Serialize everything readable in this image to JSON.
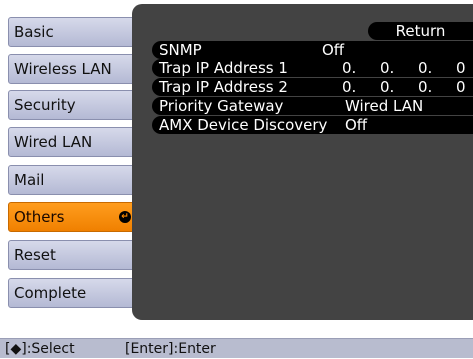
{
  "sidebar": {
    "items": [
      {
        "label": "Basic"
      },
      {
        "label": "Wireless LAN"
      },
      {
        "label": "Security"
      },
      {
        "label": "Wired LAN"
      },
      {
        "label": "Mail"
      },
      {
        "label": "Others",
        "selected": true
      },
      {
        "label": "Reset"
      },
      {
        "label": "Complete"
      }
    ]
  },
  "enter_icon": "enter-arrow-icon",
  "panel": {
    "return_label": "Return",
    "settings": [
      {
        "label": "SNMP",
        "value": "Off"
      },
      {
        "label": "Trap IP Address 1",
        "octets": [
          "0.",
          "0.",
          "0.",
          "0"
        ]
      },
      {
        "label": "Trap IP Address 2",
        "octets": [
          "0.",
          "0.",
          "0.",
          "0"
        ]
      },
      {
        "label": "Priority Gateway",
        "value": "Wired LAN"
      },
      {
        "label": "AMX Device Discovery",
        "value": "Off"
      }
    ]
  },
  "footer": {
    "select_hint": "[◆]:Select",
    "enter_hint": "[Enter]:Enter"
  },
  "colors": {
    "accent": "#f58a00",
    "panel_bg": "#434343",
    "button_bg": "#c4c8de",
    "footer_bg": "#b8bccf"
  }
}
